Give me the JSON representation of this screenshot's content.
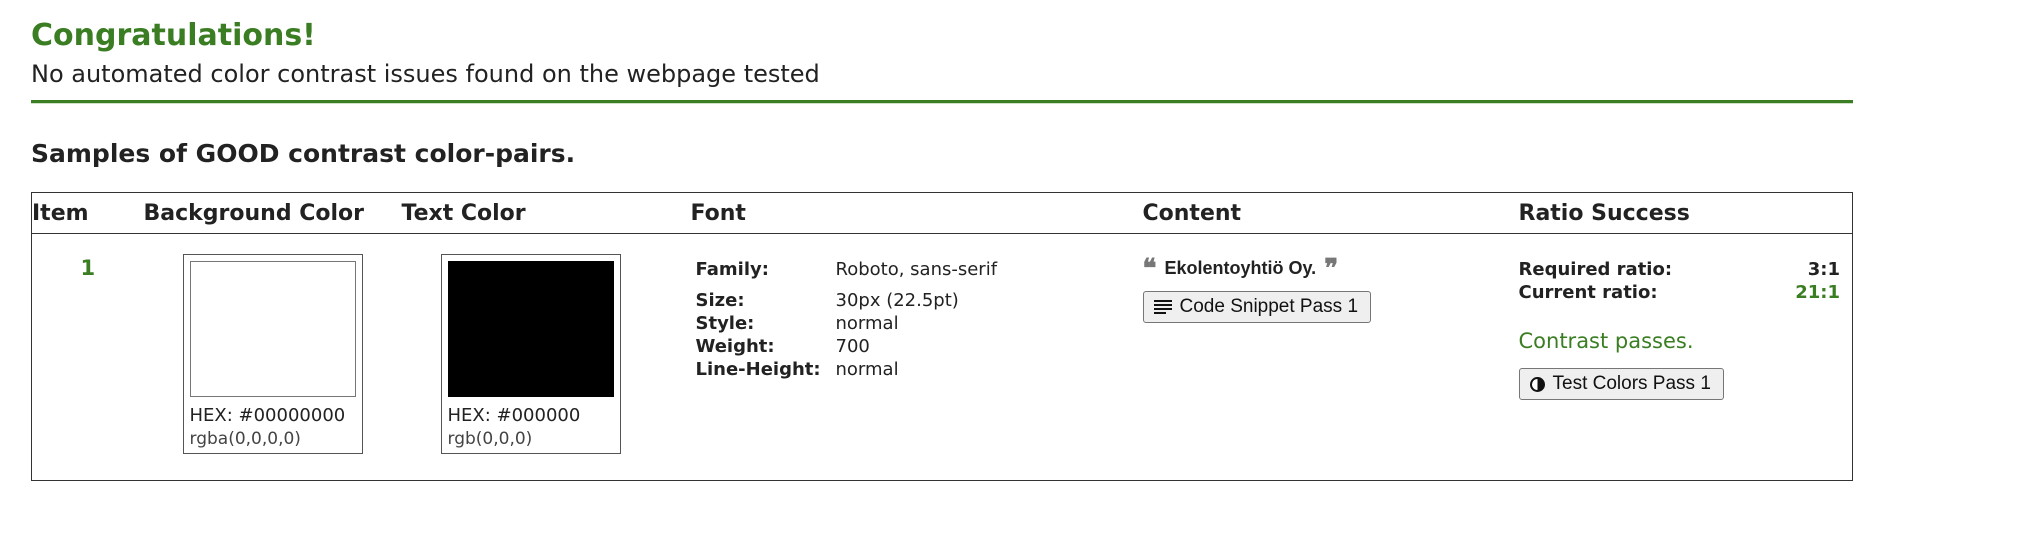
{
  "summary": {
    "heading": "Congratulations!",
    "message": "No automated color contrast issues found on the webpage tested"
  },
  "section_title": "Samples of GOOD contrast color-pairs.",
  "table": {
    "headers": {
      "item": "Item",
      "background": "Background Color",
      "text": "Text Color",
      "font": "Font",
      "content": "Content",
      "ratio": "Ratio Success"
    },
    "rows": [
      {
        "item": "1",
        "background": {
          "hex": "HEX: #00000000",
          "rgb": "rgba(0,0,0,0)",
          "swatch_color": "#ffffff"
        },
        "text": {
          "hex": "HEX: #000000",
          "rgb": "rgb(0,0,0)",
          "swatch_color": "#000000"
        },
        "font": {
          "family_label": "Family:",
          "family": "Roboto, sans-serif",
          "size_label": "Size:",
          "size": "30px (22.5pt)",
          "style_label": "Style:",
          "style": "normal",
          "weight_label": "Weight:",
          "weight": "700",
          "line_height_label": "Line-Height:",
          "line_height": "normal"
        },
        "content": {
          "quote_text": "Ekolentoyhtiö Oy.",
          "snippet_button": "Code Snippet Pass 1",
          "quote_open_icon": "quote-open-icon",
          "quote_close_icon": "quote-close-icon",
          "snippet_icon": "align-justify-icon"
        },
        "ratio": {
          "required_label": "Required ratio:",
          "required": "3:1",
          "current_label": "Current ratio:",
          "current": "21:1",
          "status": "Contrast passes.",
          "test_button": "Test Colors Pass 1",
          "test_icon": "contrast-icon"
        }
      }
    ]
  },
  "colors": {
    "success_green": "#3a7d22",
    "text": "#222222",
    "border": "#333333"
  }
}
